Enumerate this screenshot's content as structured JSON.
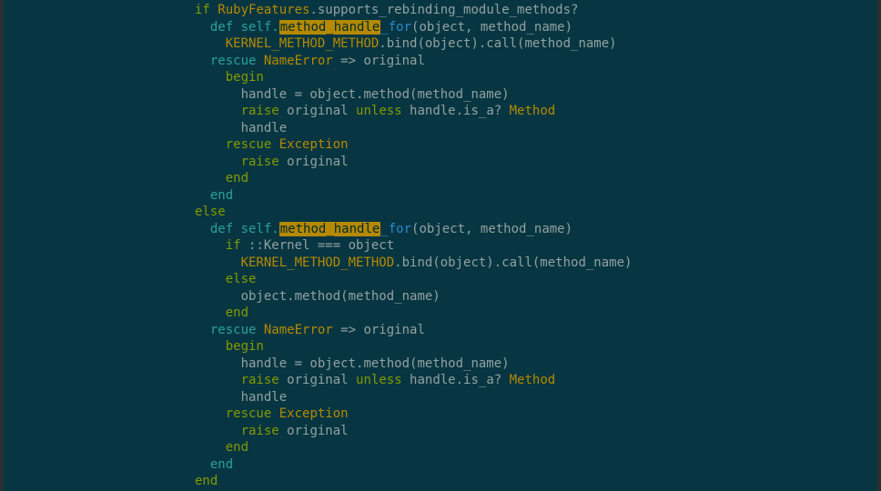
{
  "editor": {
    "lines": [
      [
        {
          "t": "if ",
          "c": "kw"
        },
        {
          "t": "RubyFeatures",
          "c": "const"
        },
        {
          "t": ".supports_rebinding_module_methods?",
          "c": "plain"
        }
      ],
      [
        {
          "t": "  "
        },
        {
          "t": "def",
          "c": "def"
        },
        {
          "t": " self.",
          "c": "def"
        },
        {
          "t": "method_handle",
          "c": "hl"
        },
        {
          "t": "_for",
          "c": "call"
        },
        {
          "t": "(object, method_name)",
          "c": "plain"
        }
      ],
      [
        {
          "t": "    "
        },
        {
          "t": "KERNEL_METHOD_METHOD",
          "c": "const"
        },
        {
          "t": ".bind(object).call(method_name)",
          "c": "plain"
        }
      ],
      [
        {
          "t": "  "
        },
        {
          "t": "rescue ",
          "c": "def"
        },
        {
          "t": "NameError",
          "c": "const"
        },
        {
          "t": " => original",
          "c": "plain"
        }
      ],
      [
        {
          "t": "    "
        },
        {
          "t": "begin",
          "c": "kw"
        }
      ],
      [
        {
          "t": "      "
        },
        {
          "t": "handle = object.method(method_name)",
          "c": "plain"
        }
      ],
      [
        {
          "t": "      "
        },
        {
          "t": "raise",
          "c": "kw"
        },
        {
          "t": " original ",
          "c": "plain"
        },
        {
          "t": "unless",
          "c": "kw"
        },
        {
          "t": " handle.is_a? ",
          "c": "plain"
        },
        {
          "t": "Method",
          "c": "const"
        }
      ],
      [
        {
          "t": "      "
        },
        {
          "t": "handle",
          "c": "plain"
        }
      ],
      [
        {
          "t": "    "
        },
        {
          "t": "rescue ",
          "c": "kw"
        },
        {
          "t": "Exception",
          "c": "const"
        }
      ],
      [
        {
          "t": "      "
        },
        {
          "t": "raise",
          "c": "kw"
        },
        {
          "t": " original",
          "c": "plain"
        }
      ],
      [
        {
          "t": "    "
        },
        {
          "t": "end",
          "c": "kw"
        }
      ],
      [
        {
          "t": "  "
        },
        {
          "t": "end",
          "c": "def"
        }
      ],
      [
        {
          "t": "else",
          "c": "kw"
        }
      ],
      [
        {
          "t": "  "
        },
        {
          "t": "def",
          "c": "def"
        },
        {
          "t": " self.",
          "c": "def"
        },
        {
          "t": "method_handle",
          "c": "hl"
        },
        {
          "t": "_for",
          "c": "call"
        },
        {
          "t": "(object, method_name)",
          "c": "plain"
        }
      ],
      [
        {
          "t": "    "
        },
        {
          "t": "if",
          "c": "kw"
        },
        {
          "t": " ::Kernel === object",
          "c": "plain"
        }
      ],
      [
        {
          "t": "      "
        },
        {
          "t": "KERNEL_METHOD_METHOD",
          "c": "const"
        },
        {
          "t": ".bind(object).call(method_name)",
          "c": "plain"
        }
      ],
      [
        {
          "t": "    "
        },
        {
          "t": "else",
          "c": "kw"
        }
      ],
      [
        {
          "t": "      "
        },
        {
          "t": "object.method(method_name)",
          "c": "plain"
        }
      ],
      [
        {
          "t": "    "
        },
        {
          "t": "end",
          "c": "kw"
        }
      ],
      [
        {
          "t": "  "
        },
        {
          "t": "rescue ",
          "c": "def"
        },
        {
          "t": "NameError",
          "c": "const"
        },
        {
          "t": " => original",
          "c": "plain"
        }
      ],
      [
        {
          "t": "    "
        },
        {
          "t": "begin",
          "c": "kw"
        }
      ],
      [
        {
          "t": "      "
        },
        {
          "t": "handle = object.method(method_name)",
          "c": "plain"
        }
      ],
      [
        {
          "t": "      "
        },
        {
          "t": "raise",
          "c": "kw"
        },
        {
          "t": " original ",
          "c": "plain"
        },
        {
          "t": "unless",
          "c": "kw"
        },
        {
          "t": " handle.is_a? ",
          "c": "plain"
        },
        {
          "t": "Method",
          "c": "const"
        }
      ],
      [
        {
          "t": "      "
        },
        {
          "t": "handle",
          "c": "plain"
        }
      ],
      [
        {
          "t": "    "
        },
        {
          "t": "rescue ",
          "c": "kw"
        },
        {
          "t": "Exception",
          "c": "const"
        }
      ],
      [
        {
          "t": "      "
        },
        {
          "t": "raise",
          "c": "kw"
        },
        {
          "t": " original",
          "c": "plain"
        }
      ],
      [
        {
          "t": "    "
        },
        {
          "t": "end",
          "c": "kw"
        }
      ],
      [
        {
          "t": "  "
        },
        {
          "t": "end",
          "c": "def"
        }
      ],
      [
        {
          "t": "end",
          "c": "kw"
        }
      ]
    ]
  },
  "colors": {
    "background": "#073642",
    "keyword": "#859900",
    "def": "#2aa198",
    "constant": "#b58900",
    "call": "#268bd2",
    "text": "#93a1a1",
    "highlight": "#b58900"
  }
}
